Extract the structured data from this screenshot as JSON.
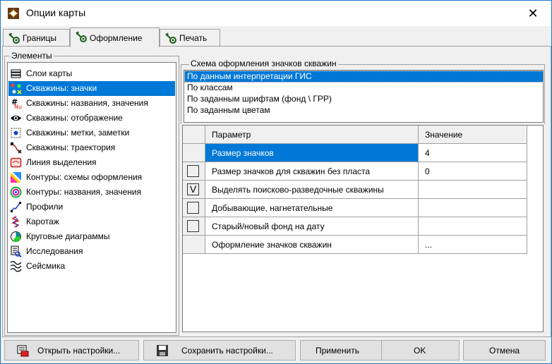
{
  "window": {
    "title": "Опции карты",
    "close_glyph": "✕"
  },
  "tabs": [
    {
      "label": "Границы",
      "icon": "gear-icon"
    },
    {
      "label": "Оформление",
      "icon": "gear-icon",
      "active": true
    },
    {
      "label": "Печать",
      "icon": "gear-icon"
    }
  ],
  "elements": {
    "label": "Элементы",
    "items": [
      {
        "label": "Слои карты",
        "icon": "layers-icon"
      },
      {
        "label": "Скважины: значки",
        "icon": "well-symbols-icon",
        "selected": true
      },
      {
        "label": "Скважины: названия, значения",
        "icon": "well-labels-icon"
      },
      {
        "label": "Скважины: отображение",
        "icon": "eye-icon"
      },
      {
        "label": "Скважины: метки, заметки",
        "icon": "marks-icon"
      },
      {
        "label": "Скважины: траектория",
        "icon": "trajectory-icon"
      },
      {
        "label": "Линия выделения",
        "icon": "selection-line-icon"
      },
      {
        "label": "Контуры: схемы оформления",
        "icon": "contour-schemes-icon"
      },
      {
        "label": "Контуры: названия, значения",
        "icon": "contour-labels-icon"
      },
      {
        "label": "Профили",
        "icon": "profiles-icon"
      },
      {
        "label": "Каротаж",
        "icon": "logging-icon"
      },
      {
        "label": "Круговые диаграммы",
        "icon": "pie-chart-icon"
      },
      {
        "label": "Исследования",
        "icon": "research-icon"
      },
      {
        "label": "Сейсмика",
        "icon": "seismic-icon"
      }
    ]
  },
  "scheme": {
    "label": "Схема оформления значков скважин",
    "options": [
      {
        "label": "По данным интерпретации ГИС",
        "selected": true
      },
      {
        "label": "По классам"
      },
      {
        "label": "По заданным шрифтам (фонд \\ ГРР)"
      },
      {
        "label": "По заданным цветам"
      }
    ]
  },
  "grid": {
    "headers": {
      "param": "Параметр",
      "value": "Значение"
    },
    "rows": [
      {
        "param": "Размер значков",
        "value": "4",
        "checkbox": false,
        "checked": false,
        "selected": true
      },
      {
        "param": "Размер значков для скважин без пласта",
        "value": "0",
        "checkbox": true,
        "checked": false
      },
      {
        "param": "Выделять поисково-разведочные скважины",
        "value": "",
        "checkbox": true,
        "checked": true,
        "check_glyph": "V"
      },
      {
        "param": "Добывающие, нагнетательные",
        "value": "",
        "checkbox": true,
        "checked": false
      },
      {
        "param": "Старый/новый фонд на дату",
        "value": "",
        "checkbox": true,
        "checked": false
      },
      {
        "param": "Оформление значков скважин",
        "value": "...",
        "checkbox": false,
        "checked": false
      }
    ]
  },
  "buttons": {
    "open": "Открыть настройки...",
    "save": "Сохранить настройки...",
    "apply": "Применить",
    "ok": "OK",
    "cancel": "Отмена"
  }
}
